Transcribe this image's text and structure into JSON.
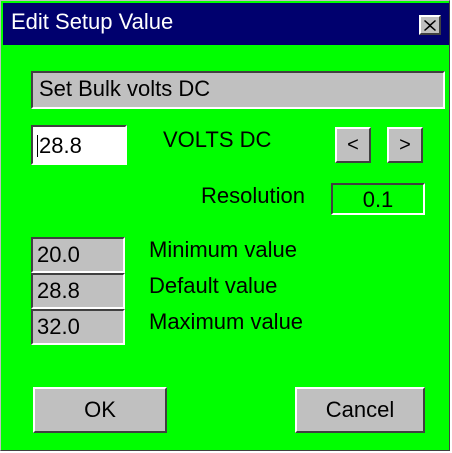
{
  "window": {
    "title": "Edit Setup Value",
    "close_glyph": "✕"
  },
  "setting": {
    "description": "Set Bulk volts DC",
    "value": "28.8",
    "units": "VOLTS DC",
    "decrement_glyph": "<",
    "increment_glyph": ">",
    "resolution_label": "Resolution",
    "resolution": "0.1"
  },
  "range": {
    "minimum": {
      "value": "20.0",
      "label": "Minimum value"
    },
    "default": {
      "value": "28.8",
      "label": "Default value"
    },
    "maximum": {
      "value": "32.0",
      "label": "Maximum value"
    }
  },
  "buttons": {
    "ok": "OK",
    "cancel": "Cancel"
  },
  "colors": {
    "background": "#00ff00",
    "titlebar": "#00006e",
    "control_face": "#c0c0c0"
  }
}
